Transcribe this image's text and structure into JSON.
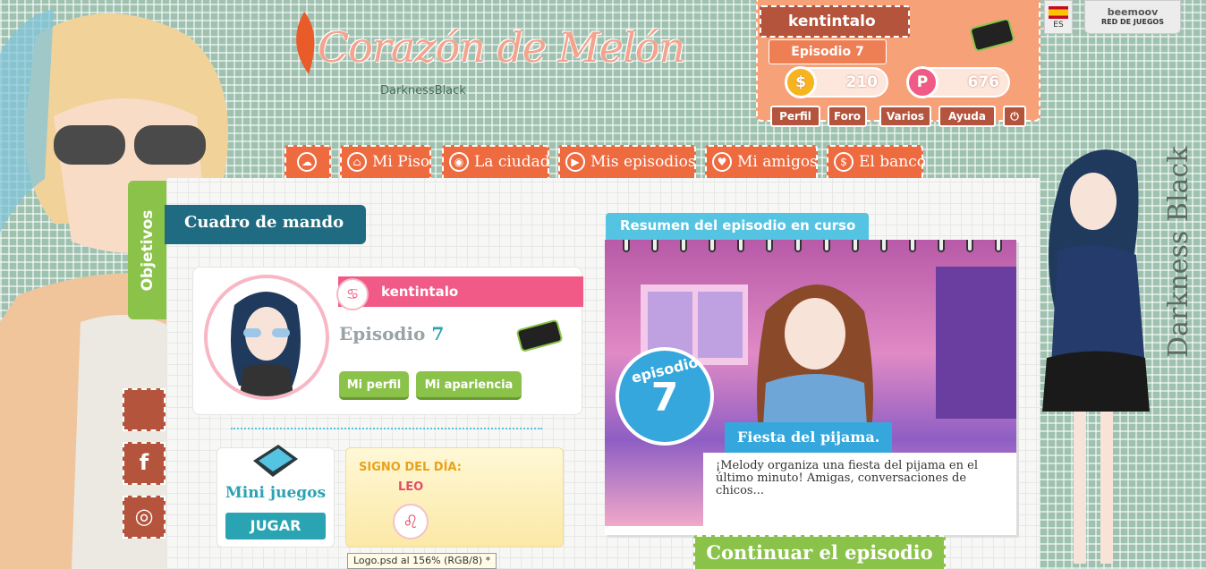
{
  "logo": {
    "title": "Corazón de Melón",
    "subtitle": "DarknessBlack"
  },
  "player": {
    "name": "kentintalo",
    "episode_label": "Episodio",
    "episode_number": "7",
    "coins": "210",
    "points": "676",
    "buttons": [
      "Perfil",
      "Foro",
      "Varios",
      "Ayuda"
    ]
  },
  "lang": {
    "code": "ES"
  },
  "network": {
    "logo": "beemoov",
    "label": "RED DE JUEGOS"
  },
  "nav": [
    {
      "label": "",
      "icon": "home-cloud-icon"
    },
    {
      "label": "Mi Piso",
      "icon": "house-icon"
    },
    {
      "label": "La ciudad",
      "icon": "map-pin-icon"
    },
    {
      "label": "Mis episodios",
      "icon": "play-icon"
    },
    {
      "label": "Mi amigos",
      "icon": "heart-icon"
    },
    {
      "label": "El banco",
      "icon": "coin-icon"
    }
  ],
  "sidebar": {
    "objetivos": "Objetivos"
  },
  "dashboard": {
    "title": "Cuadro de mando"
  },
  "profile": {
    "name": "kentintalo",
    "episode_label": "Episodio",
    "episode_number": "7",
    "btn_profile": "Mi perfil",
    "btn_appearance": "Mi apariencia",
    "zodiac_glyph": "♋"
  },
  "minigames": {
    "title": "Mini juegos",
    "button": "JUGAR"
  },
  "sign_of_day": {
    "title": "SIGNO DEL DÍA:",
    "sign": "LEO",
    "glyph": "♌"
  },
  "summary": {
    "tab": "Resumen del episodio en curso",
    "badge_label": "episodio",
    "badge_number": "7",
    "episode_title": "Fiesta del pijama.",
    "description": "¡Melody organiza una fiesta del pijama en el último minuto! Amigas, conversaciones de chicos..."
  },
  "continue_button": "Continuar el episodio",
  "tooltip": "Logo.psd al 156% (RGB/8) *",
  "watermark": "Darkness Black",
  "colors": {
    "orange": "#ee6a3f",
    "rust": "#b4543c",
    "green": "#8bc34a",
    "teal": "#2aa3b2",
    "blue": "#35a7dc",
    "pink": "#f15a86"
  }
}
